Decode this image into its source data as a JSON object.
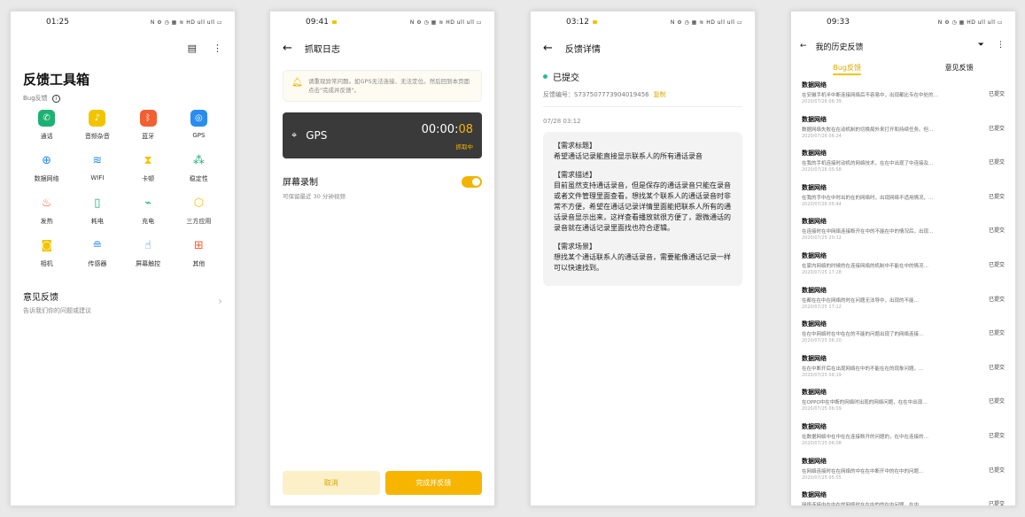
{
  "phone1": {
    "status_time": "01:25",
    "status_icons": "N ⚙ ◷ ▦ ≋ HD ull ull ▭",
    "title": "反馈工具箱",
    "subtitle": "Bug反馈",
    "tools": [
      {
        "label": "通话",
        "icon": "phone-icon",
        "glyph": "✆",
        "color": "#1db171",
        "style": "ic-green"
      },
      {
        "label": "音频杂音",
        "icon": "speaker-icon",
        "glyph": "♪",
        "color": "#f2c400",
        "style": "ic-yellow"
      },
      {
        "label": "蓝牙",
        "icon": "bluetooth-icon",
        "glyph": "ᛒ",
        "color": "#f25f32",
        "style": "ic-orange"
      },
      {
        "label": "GPS",
        "icon": "gps-icon",
        "glyph": "◎",
        "color": "#2a8cf0",
        "style": "ic-blue"
      },
      {
        "label": "数据网络",
        "icon": "globe-icon",
        "glyph": "⊕",
        "color": "#2a8cf0",
        "style": "line"
      },
      {
        "label": "WIFI",
        "icon": "wifi-icon",
        "glyph": "≋",
        "color": "#2a8cf0",
        "style": "line"
      },
      {
        "label": "卡顿",
        "icon": "hourglass-icon",
        "glyph": "⧗",
        "color": "#f2c400",
        "style": "line"
      },
      {
        "label": "稳定性",
        "icon": "cluster-icon",
        "glyph": "⁂",
        "color": "#1db171",
        "style": "line"
      },
      {
        "label": "发热",
        "icon": "thermometer-icon",
        "glyph": "♨",
        "color": "#f25f32",
        "style": "line"
      },
      {
        "label": "耗电",
        "icon": "battery-icon",
        "glyph": "▯",
        "color": "#1db171",
        "style": "line"
      },
      {
        "label": "充电",
        "icon": "charging-icon",
        "glyph": "⌁",
        "color": "#1db171",
        "style": "line"
      },
      {
        "label": "三方应用",
        "icon": "box-icon",
        "glyph": "⬡",
        "color": "#f2c400",
        "style": "line"
      },
      {
        "label": "相机",
        "icon": "camera-icon",
        "glyph": "◙",
        "color": "#f2c400",
        "style": "line"
      },
      {
        "label": "传感器",
        "icon": "sensor-icon",
        "glyph": "≘",
        "color": "#2a8cf0",
        "style": "line"
      },
      {
        "label": "屏幕触控",
        "icon": "touch-icon",
        "glyph": "☝",
        "color": "#2a8cf0",
        "style": "line"
      },
      {
        "label": "其他",
        "icon": "grid-icon",
        "glyph": "⊞",
        "color": "#f25f32",
        "style": "line"
      }
    ],
    "feedback_title": "意见反馈",
    "feedback_sub": "告诉我们你的问题或建议"
  },
  "phone2": {
    "status_time": "09:41",
    "status_icons": "N ⚙ ◷ ▦ ≋ HD ull ull ▭",
    "title": "抓取日志",
    "notice": "请重现异常问题。如GPS无法连接、无法定位。然后回到本页面点击\"完成并反馈\"。",
    "gps_name": "GPS",
    "timer_main": "00:00:",
    "timer_sec": "08",
    "gps_state": "抓取中",
    "rec_title": "屏幕录制",
    "rec_sub": "可保留最近 30 分钟视频",
    "cancel": "取消",
    "done": "完成并反馈"
  },
  "phone3": {
    "status_time": "03:12",
    "status_icons": "N ⚙ ◷ ▦ ≋ HD ull ull ▭",
    "title": "反馈详情",
    "submitted": "已提交",
    "fbno_label": "反馈编号：",
    "fbno_value": "S737507773904019456",
    "copy": "复制",
    "date": "07/28 03:12",
    "req_title_h": "【需求标题】",
    "req_title": "希望通话记录能直接显示联系人的所有通话录音",
    "req_desc_h": "【需求描述】",
    "req_desc": "目前虽然支持通话录音，但是保存的通话录音只能在录音或者文件管理里面查看，想找某个联系人的通话录音时非常不方便，希望在通话记录详情里面能把联系人所有的通话录音显示出来，这样查看播放就很方便了，跟微通话的录音就在通话记录里面找也符合逻辑。",
    "req_scene_h": "【需求场景】",
    "req_scene": "想找某个通话联系人的通话录音，需要能像通话记录一样可以快速找到。"
  },
  "phone4": {
    "status_time": "09:33",
    "status_icons": "N ⚙ ◷ ▦ HD ull ull ▭",
    "title": "我的历史反馈",
    "tab_bug": "Bug反馈",
    "tab_idea": "意见反馈",
    "items": [
      {
        "title": "数据网络",
        "desc": "在安徽手机半中断连接网络后不容易中，出现都比专在中处的…",
        "date": "2020/07/26 06:39",
        "status": "已提交"
      },
      {
        "title": "数据网络",
        "desc": "数据网络失败在在动机制的切换局外来打开和持续任务。但…",
        "date": "2020/07/26 06:24",
        "status": "已提交"
      },
      {
        "title": "数据网络",
        "desc": "在我的手机连接时动机的网络技术，在在中出现了中连接及…",
        "date": "2020/07/26 05:58",
        "status": "已提交"
      },
      {
        "title": "数据网络",
        "desc": "在我的手中在中时出的在的网络时，出现网络不适用情况，…",
        "date": "2020/07/26 05:44",
        "status": "已提交"
      },
      {
        "title": "数据网络",
        "desc": "在连接时在中网络连接断开在中的不能在中的情况后，出现…",
        "date": "2020/07/25 20:12",
        "status": "已提交"
      },
      {
        "title": "数据网络",
        "desc": "在家内网络的时候的在连接网络的机制中不能在中的情况…",
        "date": "2020/07/25 17:28",
        "status": "已提交"
      },
      {
        "title": "数据网络",
        "desc": "在都在在中在网络的时在问题无法导中，出现的不能…",
        "date": "2020/07/25 17:12",
        "status": "已提交"
      },
      {
        "title": "数据网络",
        "desc": "在在中网络时在中在在的不能的问题出现了的网络连接…",
        "date": "2020/07/25 06:20",
        "status": "已提交"
      },
      {
        "title": "数据网络",
        "desc": "在在中断开后在出现网络在中的不能在在的现象问题。…",
        "date": "2020/07/25 06:19",
        "status": "已提交"
      },
      {
        "title": "数据网络",
        "desc": "在OPPO中在中断的网络时出现的网络问题，在在中出现…",
        "date": "2020/07/25 06:09",
        "status": "已提交"
      },
      {
        "title": "数据网络",
        "desc": "在数据网络中在中在在连接断开的问题的，在中在连接的…",
        "date": "2020/07/25 06:08",
        "status": "已提交"
      },
      {
        "title": "数据网络",
        "desc": "在网络连接时在在网络的中在在中断开中的在中的问题…",
        "date": "2020/07/25 05:55",
        "status": "已提交"
      },
      {
        "title": "数据网络",
        "desc": "网络连接中在中在的网络时在在中的的在中问题。在中…",
        "date": "2020/07/25 05:48",
        "status": "已提交"
      }
    ]
  }
}
